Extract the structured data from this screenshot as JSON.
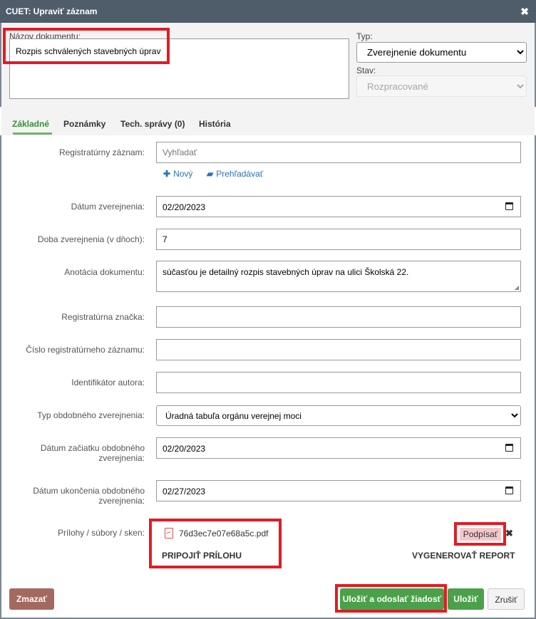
{
  "window": {
    "title": "CUET: Upraviť záznam",
    "close_symbol": "✖"
  },
  "document_name": {
    "label": "Názov dokumentu:",
    "value": "Rozpis schválených stavebných úprav"
  },
  "type": {
    "label": "Typ:",
    "selected": "Zverejnenie dokumentu"
  },
  "state": {
    "label": "Stav:",
    "selected": "Rozpracované"
  },
  "tabs": [
    {
      "label": "Základné",
      "active": true
    },
    {
      "label": "Poznámky",
      "active": false
    },
    {
      "label": "Tech. správy (0)",
      "active": false
    },
    {
      "label": "História",
      "active": false
    }
  ],
  "form": {
    "registry_record": {
      "label": "Registratúrny záznam:",
      "placeholder": "Vyhľadať",
      "new_link": "Nový",
      "browse_link": "Prehľadávať"
    },
    "publish_date": {
      "label": "Dátum zverejnenia:",
      "value": "02/20/2023"
    },
    "publish_days": {
      "label": "Doba zverejnenia (v dňoch):",
      "value": "7"
    },
    "annotation": {
      "label": "Anotácia dokumentu:",
      "value": "súčasťou je detailný rozpis stavebných úprav na ulici Školská 22."
    },
    "registry_mark": {
      "label": "Registratúrna značka:",
      "value": ""
    },
    "registry_number": {
      "label": "Číslo registratúrneho záznamu:",
      "value": ""
    },
    "author_id": {
      "label": "Identifikátor autora:",
      "value": ""
    },
    "similar_type": {
      "label": "Typ obdobného zverejnenia:",
      "selected": "Úradná tabuľa orgánu verejnej moci"
    },
    "similar_start": {
      "label": "Dátum začiatku obdobného zverejnenia:",
      "value": "02/20/2023"
    },
    "similar_end": {
      "label": "Dátum ukončenia obdobného zverejnenia:",
      "value": "02/27/2023"
    },
    "attachments": {
      "label": "Prílohy / súbory / sken:",
      "file": "76d3ec7e07e68a5c.pdf",
      "attach_button": "PRIPOJIŤ PRÍLOHU",
      "sign_button": "Podpísať",
      "remove_symbol": "✖",
      "report_button": "VYGENEROVAŤ REPORT"
    }
  },
  "footer": {
    "delete": "Zmazať",
    "save_send": "Uložiť a odoslať žiadosť",
    "save": "Uložiť",
    "cancel": "Zrušiť"
  },
  "colors": {
    "titlebar": "#4f5d6b",
    "accent_green": "#4aa14a",
    "delete_brown": "#a5685f",
    "highlight_red": "#e31b23",
    "link_blue": "#2b72b8"
  }
}
